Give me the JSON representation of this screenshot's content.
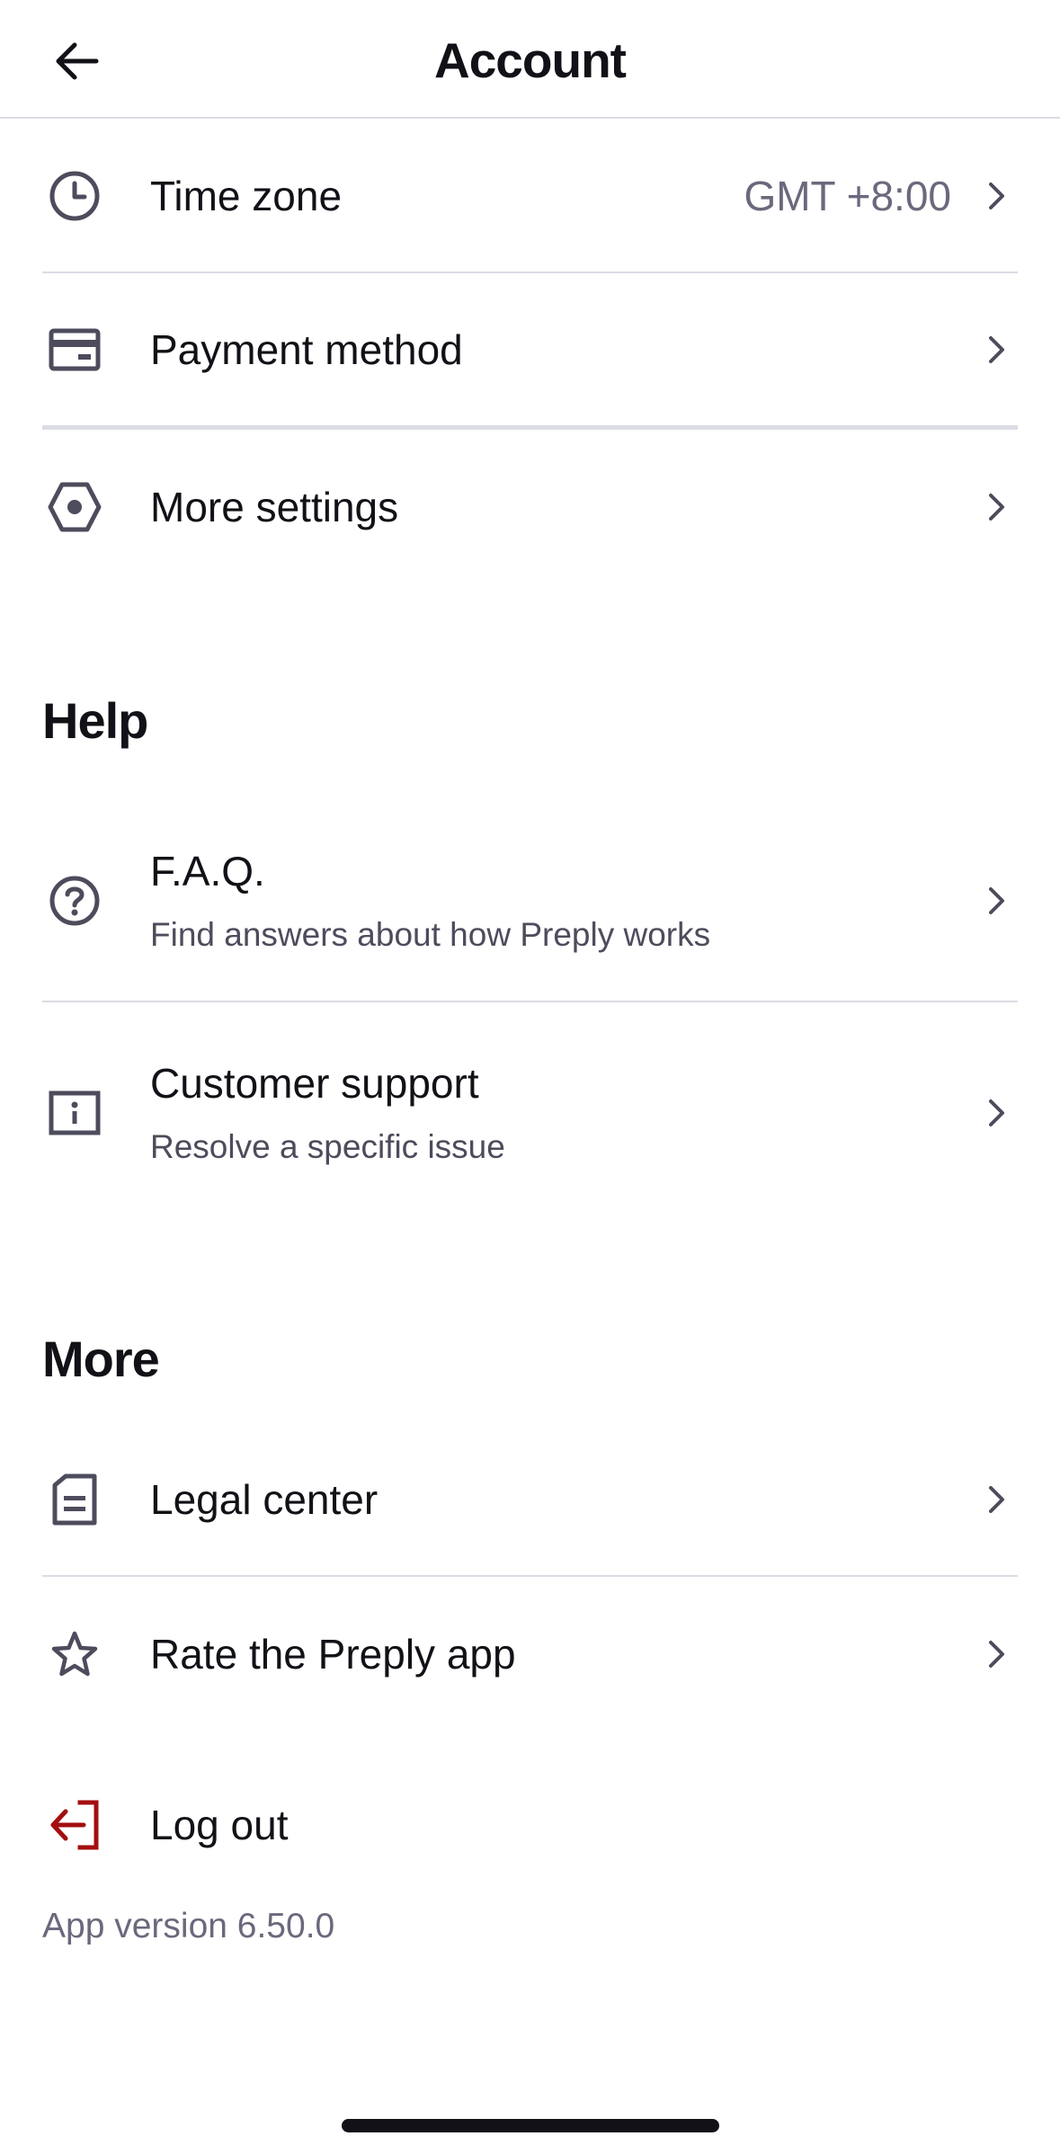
{
  "header": {
    "title": "Account"
  },
  "account_items": [
    {
      "label": "Time zone",
      "value": "GMT +8:00",
      "icon": "clock-icon"
    },
    {
      "label": "Payment method",
      "icon": "credit-card-icon"
    },
    {
      "label": "More settings",
      "icon": "hexagon-settings-icon"
    }
  ],
  "help": {
    "title": "Help",
    "items": [
      {
        "label": "F.A.Q.",
        "sub": "Find answers about how Preply works",
        "icon": "question-circle-icon"
      },
      {
        "label": "Customer support",
        "sub": "Resolve a specific issue",
        "icon": "info-square-icon"
      }
    ]
  },
  "more": {
    "title": "More",
    "items": [
      {
        "label": "Legal center",
        "icon": "document-icon"
      },
      {
        "label": "Rate the Preply app",
        "icon": "star-icon"
      }
    ]
  },
  "logout": {
    "label": "Log out",
    "icon": "logout-icon",
    "color": "#a30f0f"
  },
  "app_version": "App version 6.50.0",
  "colors": {
    "text": "#121117",
    "muted": "#6a697c",
    "divider": "#dcdce5",
    "icon": "#4d4c5c",
    "danger": "#a30f0f"
  }
}
